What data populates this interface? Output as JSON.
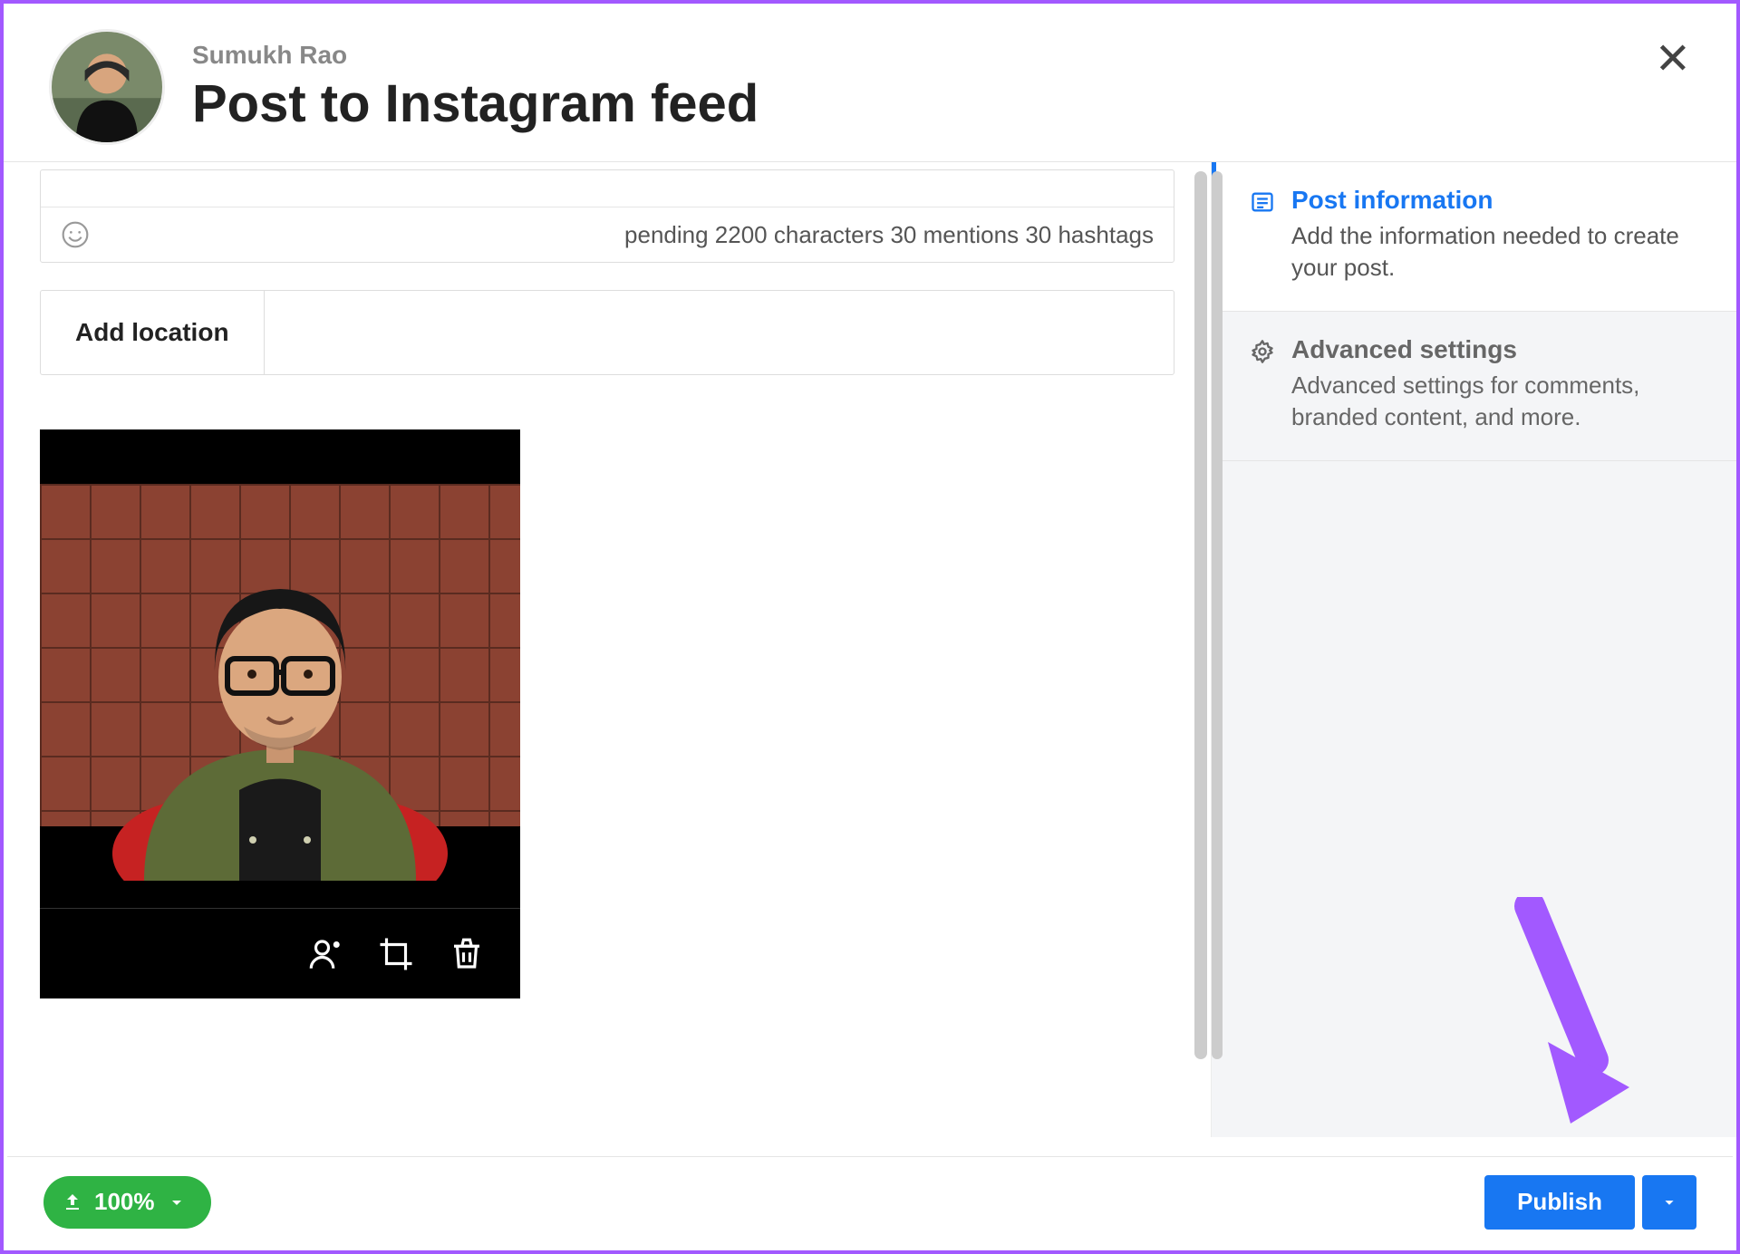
{
  "header": {
    "username": "Sumukh Rao",
    "title": "Post to Instagram feed"
  },
  "caption": {
    "counter_text": "pending 2200 characters 30 mentions 30 hashtags"
  },
  "location": {
    "label": "Add location"
  },
  "sidebar": {
    "post_info": {
      "title": "Post information",
      "desc": "Add the information needed to create your post."
    },
    "advanced": {
      "title": "Advanced settings",
      "desc": "Advanced settings for comments, branded content, and more."
    }
  },
  "footer": {
    "upload_percent": "100%",
    "publish_label": "Publish"
  }
}
